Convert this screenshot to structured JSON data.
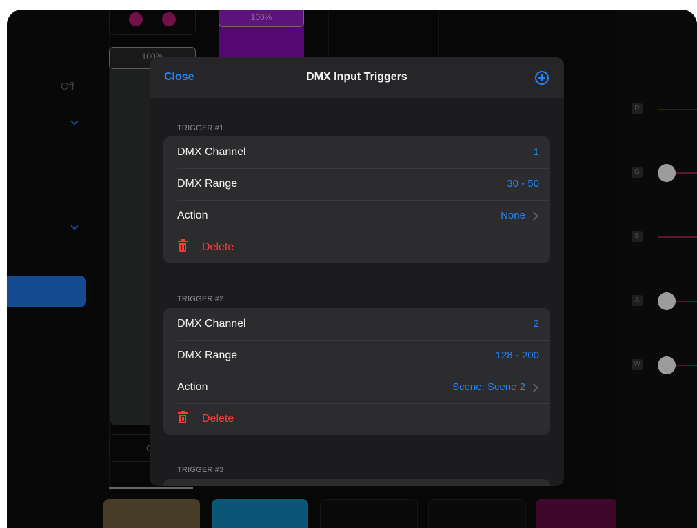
{
  "background": {
    "mode_label": "Off",
    "fader_value": "100%",
    "purple_fader_value": "100%",
    "small_button_label": "Co",
    "rgb_channels": [
      "R",
      "G",
      "B",
      "A",
      "W"
    ]
  },
  "modal": {
    "close_label": "Close",
    "title": "DMX Input Triggers",
    "add_icon": "plus-circle-icon",
    "triggers": [
      {
        "section": "TRIGGER #1",
        "channel_label": "DMX Channel",
        "channel_value": "1",
        "range_label": "DMX Range",
        "range_value": "30 -  50",
        "action_label": "Action",
        "action_value": "None",
        "delete_label": "Delete"
      },
      {
        "section": "TRIGGER #2",
        "channel_label": "DMX Channel",
        "channel_value": "2",
        "range_label": "DMX Range",
        "range_value": "128 - 200",
        "action_label": "Action",
        "action_value": "Scene: Scene 2",
        "delete_label": "Delete"
      },
      {
        "section": "TRIGGER #3"
      }
    ]
  },
  "colors": {
    "accent": "#1f86ff",
    "destructive": "#ff3b30",
    "modal_bg": "#1c1c1e",
    "card_bg": "#2c2c2e"
  }
}
